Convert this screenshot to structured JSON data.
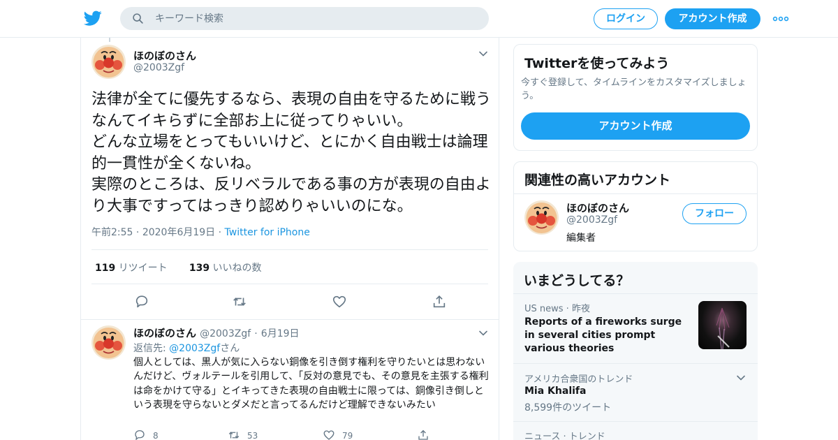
{
  "header": {
    "search_placeholder": "キーワード検索",
    "login_label": "ログイン",
    "signup_label": "アカウント作成"
  },
  "tweet": {
    "name": "ほのぼのさん",
    "handle": "@2003Zgf",
    "text": "法律が全てに優先するなら、表現の自由を守るために戦うなんてイキらずに全部お上に従ってりゃいい。\nどんな立場をとってもいいけど、とにかく自由戦士は論理的一貫性が全くないね。\n実際のところは、反リベラルである事の方が表現の自由より大事ですってはっきり認めりゃいいのにな。",
    "time": "午前2:55",
    "date": "2020年6月19日",
    "source": "Twitter for iPhone",
    "retweets_count": "119",
    "retweets_label": "リツイート",
    "likes_count": "139",
    "likes_label": "いいねの数"
  },
  "reply": {
    "name": "ほのぼのさん",
    "handle": "@2003Zgf",
    "date": "6月19日",
    "reply_prefix": "返信先:",
    "reply_to": "@2003Zgf",
    "reply_suffix": "さん",
    "text": "個人としては、黒人が気に入らない銅像を引き倒す権利を守りたいとは思わないんだけど、ヴォルテールを引用して、「反対の意見でも、その意見を主張する権利は命をかけて守る」とイキってきた表現の自由戦士に限っては、銅像引き倒しという表現を守らないとダメだと言ってるんだけど理解できないみたい",
    "replies": "8",
    "retweets": "53",
    "likes": "79"
  },
  "sidebar": {
    "promo": {
      "title": "Twitterを使ってみよう",
      "subtitle": "今すぐ登録して、タイムラインをカスタマイズしましょう。",
      "button": "アカウント作成"
    },
    "related": {
      "title": "関連性の高いアカウント",
      "name": "ほのぼのさん",
      "handle": "@2003Zgf",
      "bio": "編集者",
      "follow_label": "フォロー"
    },
    "trends": {
      "title": "いまどうしてる？",
      "items": [
        {
          "meta": "US news · 昨夜",
          "title": "Reports of a fireworks surge in several cities prompt various theories",
          "count": ""
        },
        {
          "meta": "アメリカ合衆国のトレンド",
          "title": "Mia Khalifa",
          "count": "8,599件のツイート"
        },
        {
          "meta": "ニュース · トレンド",
          "title": "",
          "count": ""
        }
      ]
    }
  },
  "colors": {
    "brand_blue": "#1da1f2",
    "link_blue": "#1b95e0",
    "secondary_text": "#657786",
    "border": "#e6ecf0"
  },
  "icons": [
    "twitter-bird-icon",
    "search-icon",
    "more-dots-icon",
    "chevron-down-icon",
    "reply-icon",
    "retweet-icon",
    "like-icon",
    "share-icon"
  ]
}
